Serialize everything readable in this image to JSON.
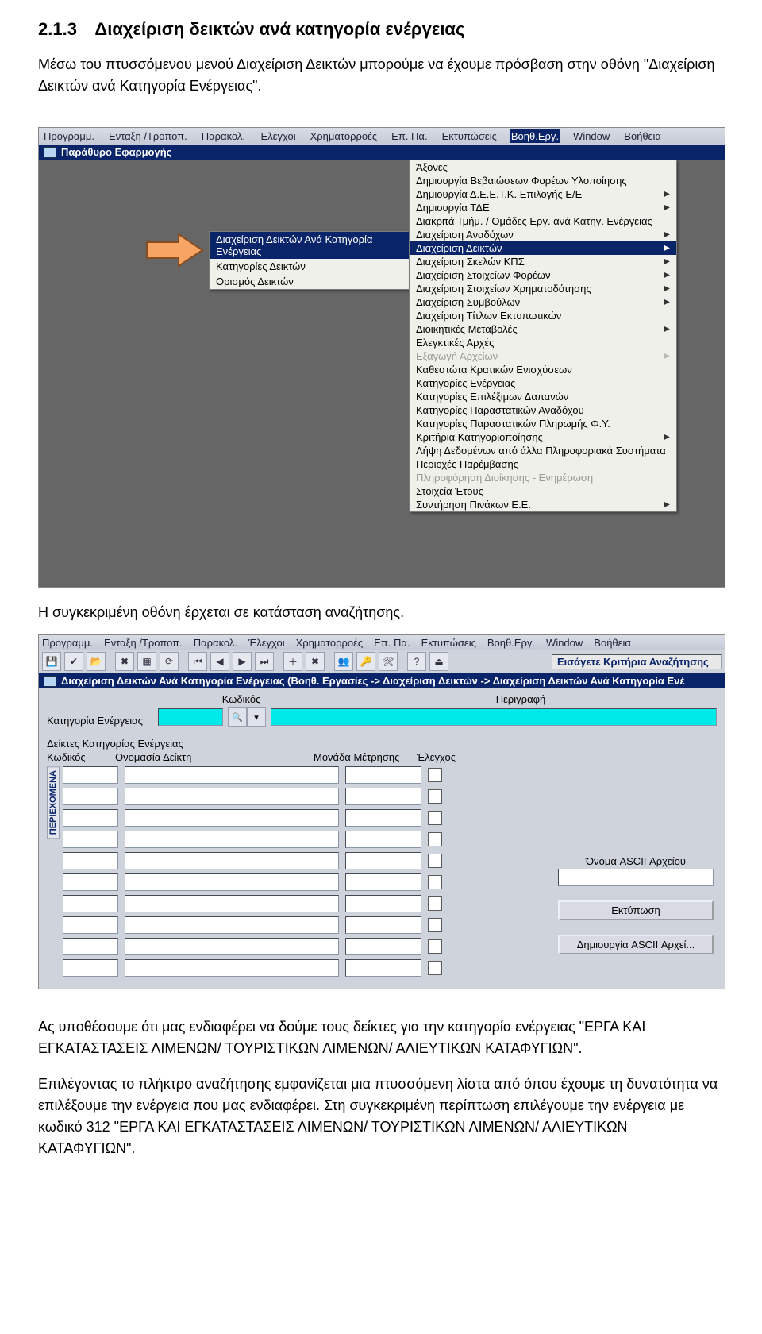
{
  "section": {
    "number": "2.1.3",
    "title": "Διαχείριση δεικτών ανά κατηγορία ενέργειας"
  },
  "paragraphs": {
    "p1": "Μέσω του πτυσσόμενου μενού Διαχείριση Δεικτών μπορούμε να έχουμε πρόσβαση στην οθόνη \"Διαχείριση Δεικτών ανά Κατηγορία Ενέργειας\".",
    "p2": "Η συγκεκριμένη οθόνη έρχεται σε κατάσταση αναζήτησης.",
    "p3": "Ας υποθέσουμε ότι μας ενδιαφέρει να δούμε τους δείκτες για την κατηγορία ενέργειας \"ΕΡΓΑ ΚΑΙ ΕΓΚΑΤΑΣΤΑΣΕΙΣ ΛΙΜΕΝΩΝ/ ΤΟΥΡΙΣΤΙΚΩΝ ΛΙΜΕΝΩΝ/ ΑΛΙΕΥΤΙΚΩΝ ΚΑΤΑΦΥΓΙΩΝ\".",
    "p4": "Επιλέγοντας το πλήκτρο αναζήτησης εμφανίζεται μια πτυσσόμενη λίστα από όπου έχουμε τη δυνατότητα να επιλέξουμε την ενέργεια που μας ενδιαφέρει. Στη συγκεκριμένη περίπτωση επιλέγουμε την ενέργεια με κωδικό 312 \"ΕΡΓΑ ΚΑΙ ΕΓΚΑΤΑΣΤΑΣΕΙΣ ΛΙΜΕΝΩΝ/ ΤΟΥΡΙΣΤΙΚΩΝ ΛΙΜΕΝΩΝ/ ΑΛΙΕΥΤΙΚΩΝ ΚΑΤΑΦΥΓΙΩΝ\"."
  },
  "menubar": {
    "items": [
      "Προγραμμ.",
      "Ενταξη /Τροποπ.",
      "Παρακολ.",
      "Έλεγχοι",
      "Χρηματορροές",
      "Επ. Πα.",
      "Εκτυπώσεις",
      "Βοηθ.Εργ.",
      "Window",
      "Βοήθεια"
    ],
    "selectedIndex": 7
  },
  "app1": {
    "title": "Παράθυρο Εφαρμογής"
  },
  "submenu1": {
    "items": [
      {
        "label": "Διαχείριση Δεικτών Ανά Κατηγορία Ενέργειας",
        "selected": true
      },
      {
        "label": "Κατηγορίες Δεικτών"
      },
      {
        "label": "Ορισμός Δεικτών"
      }
    ]
  },
  "mainmenu": {
    "items": [
      {
        "label": "Άξονες"
      },
      {
        "label": "Δημιουργία Βεβαιώσεων Φορέων Υλοποίησης"
      },
      {
        "label": "Δημιουργία Δ.Ε.Ε.Τ.Κ. Επιλογής Ε/Ε",
        "arrow": true
      },
      {
        "label": "Δημιουργία ΤΔΕ",
        "arrow": true
      },
      {
        "label": "Διακριτά Τμήμ. / Ομάδες Εργ. ανά Κατηγ. Ενέργειας"
      },
      {
        "label": "Διαχείριση Αναδόχων",
        "arrow": true
      },
      {
        "label": "Διαχείριση Δεικτών",
        "arrow": true,
        "selected": true
      },
      {
        "label": "Διαχείριση Σκελών ΚΠΣ",
        "arrow": true
      },
      {
        "label": "Διαχείριση Στοιχείων Φορέων",
        "arrow": true
      },
      {
        "label": "Διαχείριση Στοιχείων Χρηματοδότησης",
        "arrow": true
      },
      {
        "label": "Διαχείριση Συμβούλων",
        "arrow": true
      },
      {
        "label": "Διαχείριση Τίτλων Εκτυπωτικών"
      },
      {
        "label": "Διοικητικές Μεταβολές",
        "arrow": true
      },
      {
        "label": "Ελεγκτικές Αρχές"
      },
      {
        "label": "Εξαγωγή Αρχείων",
        "arrow": true,
        "disabled": true
      },
      {
        "label": "Καθεστώτα Κρατικών Ενισχύσεων"
      },
      {
        "label": "Κατηγορίες Ενέργειας"
      },
      {
        "label": "Κατηγορίες Επιλέξιμων Δαπανών"
      },
      {
        "label": "Κατηγορίες Παραστατικών Αναδόχου"
      },
      {
        "label": "Κατηγορίες Παραστατικών Πληρωμής Φ.Υ."
      },
      {
        "label": "Κριτήρια Κατηγοριοποίησης",
        "arrow": true
      },
      {
        "label": "Λήψη Δεδομένων από άλλα Πληροφοριακά Συστήματα"
      },
      {
        "label": "Περιοχές Παρέμβασης"
      },
      {
        "label": "Πληροφόρηση Διοίκησης - Ενημέρωση",
        "disabled": true
      },
      {
        "label": "Στοιχεία Έτους"
      },
      {
        "label": "Συντήρηση Πινάκων Ε.Ε.",
        "arrow": true
      }
    ]
  },
  "app2": {
    "title": "Διαχείριση Δεικτών Ανά Κατηγορία Ενέργειας (Βοηθ. Εργασίες -> Διαχείριση Δεικτών -> Διαχείριση Δεικτών Ανά Κατηγορία Ενέ",
    "searchBanner": "Εισάγετε Κριτήρια Αναζήτησης",
    "labels": {
      "kodikos": "Κωδικός",
      "perigrafi": "Περιγραφή",
      "katigoria": "Κατηγορία Ενέργειας",
      "deiktes": "Δείκτες Κατηγορίας Ενέργειας",
      "col_kodikos": "Κωδικός",
      "col_onomasia": "Ονομασία Δείκτη",
      "col_monada": "Μονάδα Μέτρησης",
      "col_elegxos": "Έλεγχος",
      "ascii": "Όνομα ASCII Αρχείου",
      "print": "Εκτύπωση",
      "create_ascii": "Δημιουργία ASCII Αρχεί...",
      "side_panel": "ΠΕΡΙΕΧΟΜΕΝΑ"
    }
  }
}
